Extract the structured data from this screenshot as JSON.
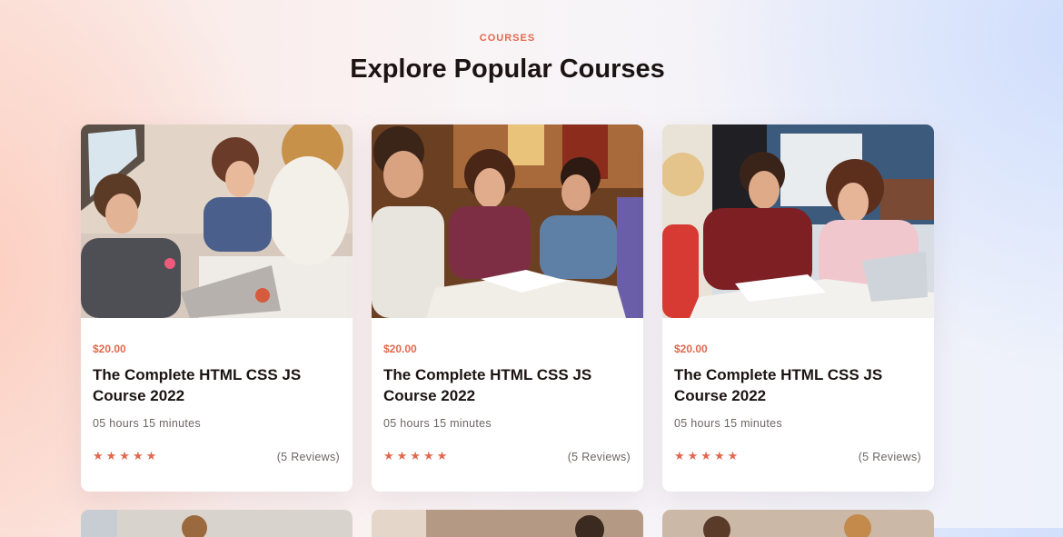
{
  "section": {
    "eyebrow": "COURSES",
    "title": "Explore Popular Courses"
  },
  "courses": [
    {
      "image": "students-studying-with-laptop-photo",
      "price": "$20.00",
      "title": "The Complete HTML CSS JS Course 2022",
      "duration": "05 hours 15 minutes",
      "rating": 5,
      "stars": "★★★★★",
      "reviews": "(5 Reviews)"
    },
    {
      "image": "students-laughing-over-book-photo",
      "price": "$20.00",
      "title": "The Complete HTML CSS JS Course 2022",
      "duration": "05 hours 15 minutes",
      "rating": 5,
      "stars": "★★★★★",
      "reviews": "(5 Reviews)"
    },
    {
      "image": "students-studying-at-desk-photo",
      "price": "$20.00",
      "title": "The Complete HTML CSS JS Course 2022",
      "duration": "05 hours 15 minutes",
      "rating": 5,
      "stars": "★★★★★",
      "reviews": "(5 Reviews)"
    }
  ],
  "colors": {
    "accent": "#e0694f",
    "heading": "#1c1413",
    "muted": "#6d6664",
    "card": "#ffffff"
  }
}
